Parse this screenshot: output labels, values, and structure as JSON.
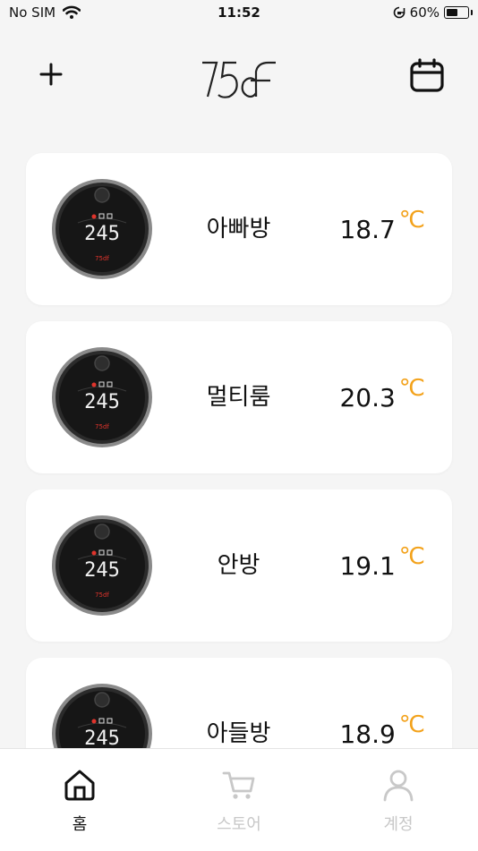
{
  "status_bar": {
    "carrier": "No SIM",
    "time": "11:52",
    "battery": "60%",
    "battery_level": 0.6
  },
  "header": {
    "logo_text": "75df",
    "add_icon": "plus-icon",
    "calendar_icon": "calendar-icon"
  },
  "rooms": [
    {
      "name": "아빠방",
      "temperature": "18.7",
      "unit": "℃",
      "display": "245"
    },
    {
      "name": "멀티룸",
      "temperature": "20.3",
      "unit": "℃",
      "display": "245"
    },
    {
      "name": "안방",
      "temperature": "19.1",
      "unit": "℃",
      "display": "245"
    },
    {
      "name": "아들방",
      "temperature": "18.9",
      "unit": "℃",
      "display": "245"
    }
  ],
  "tabs": [
    {
      "label": "홈",
      "icon": "home-icon",
      "active": true
    },
    {
      "label": "스토어",
      "icon": "cart-icon",
      "active": false
    },
    {
      "label": "계정",
      "icon": "user-icon",
      "active": false
    }
  ],
  "colors": {
    "accent_unit": "#f3a21b",
    "inactive_tab": "#c8c8c8",
    "background": "#f5f5f5"
  }
}
